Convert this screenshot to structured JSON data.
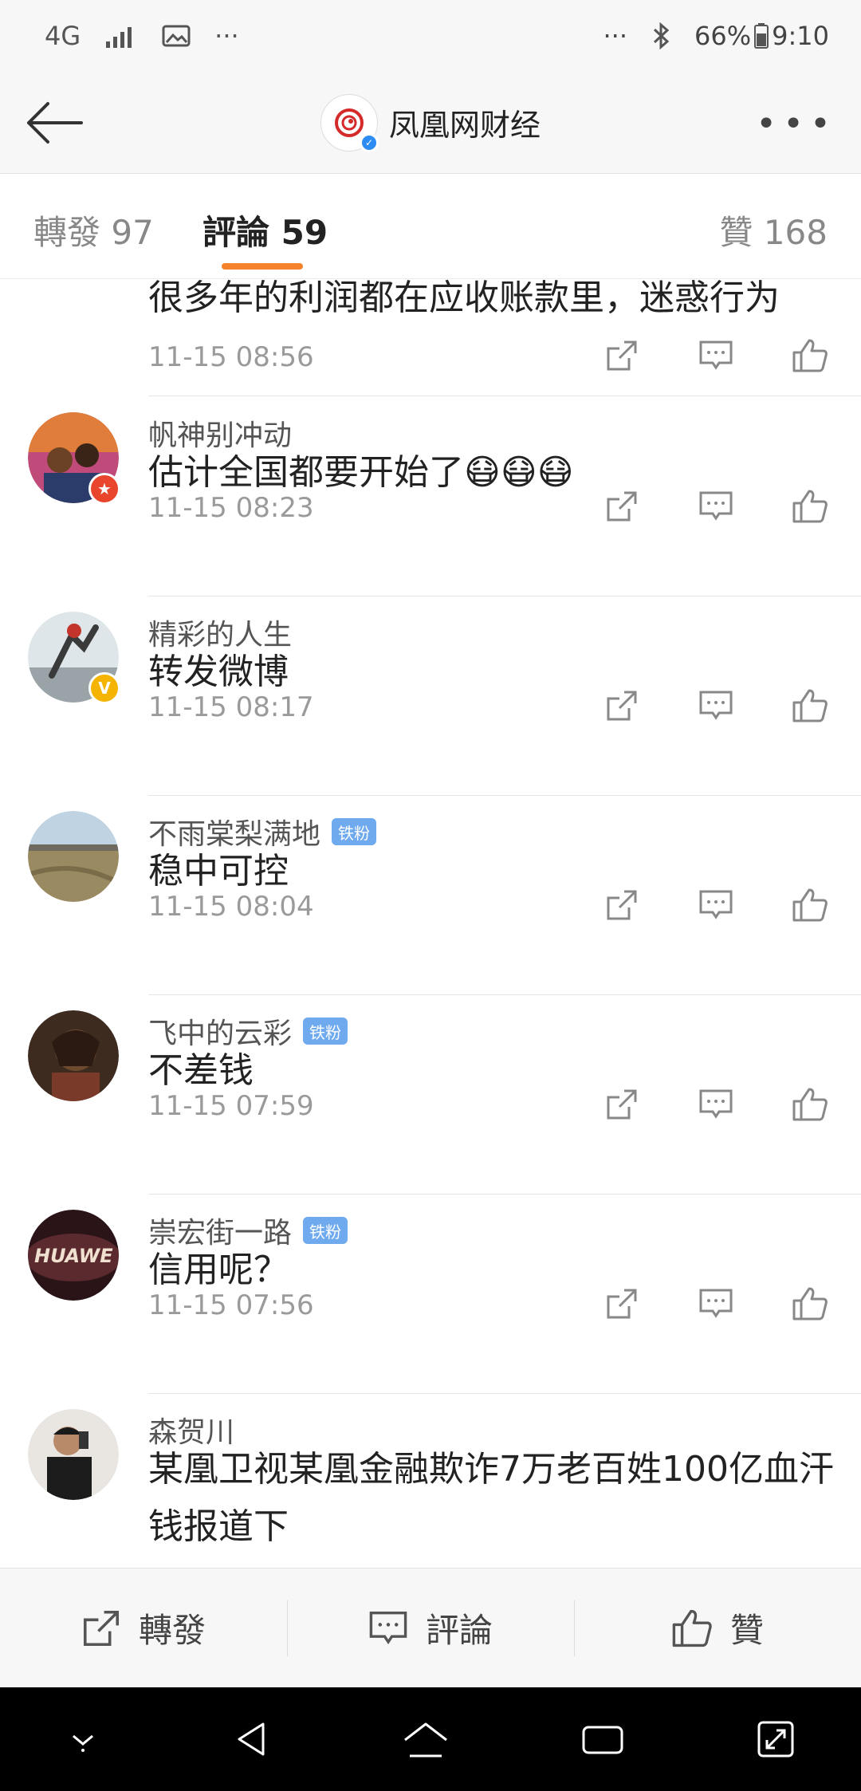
{
  "status": {
    "network": "4G",
    "dots": "···",
    "battery": "66%",
    "time": "9:10"
  },
  "header": {
    "title": "凤凰网财经",
    "logo_text": "凤凰网财经"
  },
  "tabs": [
    {
      "label": "轉發 97"
    },
    {
      "label": "評論 59"
    },
    {
      "label": "贊 168"
    }
  ],
  "comments": [
    {
      "name": "",
      "text": "很多年的利润都在应收账款里，迷惑行为",
      "time": "11-15 08:56"
    },
    {
      "name": "帆神别冲动",
      "text": "估计全国都要开始了😷😷😷",
      "time": "11-15 08:23"
    },
    {
      "name": "精彩的人生",
      "text": "转发微博",
      "time": "11-15 08:17"
    },
    {
      "name": "不雨棠梨满地",
      "badge": "铁粉",
      "text": "稳中可控",
      "time": "11-15 08:04"
    },
    {
      "name": "飞中的云彩",
      "badge": "铁粉",
      "text": "不差钱",
      "time": "11-15 07:59"
    },
    {
      "name": "崇宏街一路",
      "badge": "铁粉",
      "avatar_text": "HUAWE",
      "text": "信用呢？",
      "time": "11-15 07:56"
    },
    {
      "name": "森贺川",
      "text": "某凰卫视某凰金融欺诈7万老百姓100亿血汗钱报道下",
      "time": ""
    }
  ],
  "bottom": {
    "repost": "轉發",
    "comment": "評論",
    "like": "贊"
  },
  "colors": {
    "accent": "#f5822a",
    "fan_badge": "#6fa9ee",
    "verify_blue": "#2c8cf4",
    "verify_gold": "#f4b400",
    "star_red": "#e8452c"
  }
}
